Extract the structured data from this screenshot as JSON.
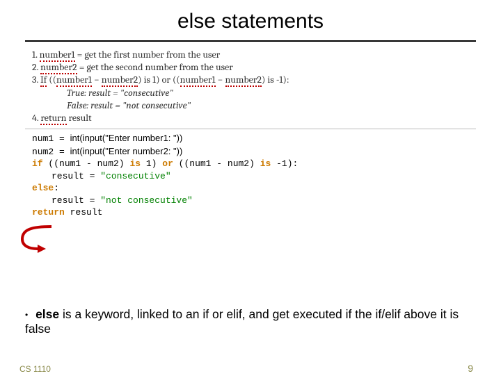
{
  "title": "else statements",
  "pseudo": {
    "l1_num": "1. ",
    "l1_a": "number1",
    "l1_b": " = get the first number from the user",
    "l2_num": "2. ",
    "l2_a": "number2",
    "l2_b": " = get the second number from the user",
    "l3_num": "3. ",
    "l3_a": "If",
    "l3_b": " ((",
    "l3_c": "number1",
    "l3_d": " − ",
    "l3_e": "number2",
    "l3_f": ") is 1) or ((",
    "l3_g": "number1",
    "l3_h": " − ",
    "l3_i": "number2",
    "l3_j": ") is -1):",
    "l4": "True: result = \"consecutive\"",
    "l5": "False: result = \"not consecutive\"",
    "l6_num": "4. ",
    "l6_a": "return",
    "l6_b": " result"
  },
  "code": {
    "l1_a": "num1",
    "l1_b": " = ",
    "l1_ov": "int(input(\"Enter number1: \"))",
    "l2_a": "num2",
    "l2_b": " = ",
    "l2_ov": "int(input(\"Enter number2: \"))",
    "l3_if": "if",
    "l3_body": " ((num1 - num2) ",
    "l3_is1": "is",
    "l3_mid": " 1) ",
    "l3_or": "or",
    "l3_body2": " ((num1 - num2) ",
    "l3_is2": "is",
    "l3_end": " -1):",
    "l4_a": "result = ",
    "l4_str": "\"consecutive\"",
    "l5_else": "else",
    "l5_colon": ":",
    "l6_a": "result = ",
    "l6_str": "\"not consecutive\"",
    "l7_ret": "return",
    "l7_b": " result"
  },
  "bullet": {
    "p1": "else",
    "p2": " is a keyword, linked to an ",
    "p3": "if",
    "p4": " or ",
    "p5": "elif",
    "p6": ", and get executed if the ",
    "p7": "if/elif",
    "p8": " above it is false"
  },
  "footer": {
    "left": "CS 1110",
    "right": "9"
  }
}
